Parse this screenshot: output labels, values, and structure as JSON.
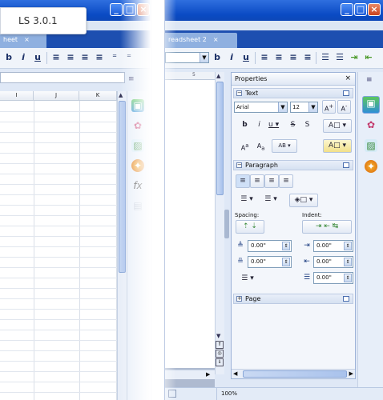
{
  "badge": "LS 3.0.1",
  "left": {
    "tab_label": "heet",
    "close": "×",
    "columns": [
      "I",
      "J",
      "K"
    ],
    "toolbar_glyphs": [
      "b",
      "i",
      "u",
      "≡",
      "≡",
      "≡",
      "≡",
      "⁼",
      "⁼"
    ]
  },
  "right": {
    "tab_label": "readsheet 2",
    "close": "×",
    "ruler_num": "5",
    "status_zoom": "100%",
    "toolbar_glyphs": [
      "b",
      "i",
      "u",
      "≡",
      "≡",
      "≡",
      "≡",
      "☰",
      "☰"
    ],
    "properties": {
      "title": "Properties",
      "close": "×",
      "text_section": "Text",
      "font_name": "Arial",
      "font_size": "12",
      "paragraph_section": "Paragraph",
      "spacing_label": "Spacing:",
      "indent_label": "Indent:",
      "spacing_above": "0.00\"",
      "spacing_below": "0.00\"",
      "indent_before": "0.00\"",
      "indent_after": "0.00\"",
      "indent_first": "0.00\"",
      "page_section": "Page"
    }
  },
  "colors": {
    "titlebar": "#0a4bc4",
    "tabstrip": "#1d4fb0",
    "panel_bg": "#f3f6fb",
    "sidebar_bg": "#e7eef9"
  },
  "icons": {
    "minimize": "minimize-icon",
    "maximize": "maximize-icon",
    "close": "close-icon",
    "sidebar": [
      "properties-icon",
      "styles-icon",
      "gallery-icon",
      "navigator-icon",
      "functions-icon"
    ]
  }
}
